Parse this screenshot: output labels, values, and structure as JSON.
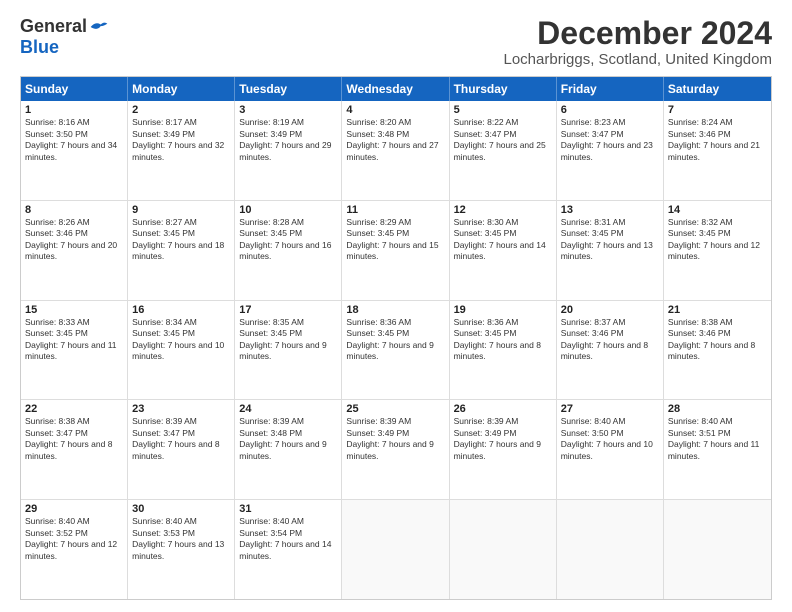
{
  "logo": {
    "general": "General",
    "blue": "Blue"
  },
  "header": {
    "title": "December 2024",
    "location": "Locharbriggs, Scotland, United Kingdom"
  },
  "days": [
    "Sunday",
    "Monday",
    "Tuesday",
    "Wednesday",
    "Thursday",
    "Friday",
    "Saturday"
  ],
  "weeks": [
    [
      {
        "day": "1",
        "sunrise": "8:16 AM",
        "sunset": "3:50 PM",
        "daylight": "7 hours and 34 minutes."
      },
      {
        "day": "2",
        "sunrise": "8:17 AM",
        "sunset": "3:49 PM",
        "daylight": "7 hours and 32 minutes."
      },
      {
        "day": "3",
        "sunrise": "8:19 AM",
        "sunset": "3:49 PM",
        "daylight": "7 hours and 29 minutes."
      },
      {
        "day": "4",
        "sunrise": "8:20 AM",
        "sunset": "3:48 PM",
        "daylight": "7 hours and 27 minutes."
      },
      {
        "day": "5",
        "sunrise": "8:22 AM",
        "sunset": "3:47 PM",
        "daylight": "7 hours and 25 minutes."
      },
      {
        "day": "6",
        "sunrise": "8:23 AM",
        "sunset": "3:47 PM",
        "daylight": "7 hours and 23 minutes."
      },
      {
        "day": "7",
        "sunrise": "8:24 AM",
        "sunset": "3:46 PM",
        "daylight": "7 hours and 21 minutes."
      }
    ],
    [
      {
        "day": "8",
        "sunrise": "8:26 AM",
        "sunset": "3:46 PM",
        "daylight": "7 hours and 20 minutes."
      },
      {
        "day": "9",
        "sunrise": "8:27 AM",
        "sunset": "3:45 PM",
        "daylight": "7 hours and 18 minutes."
      },
      {
        "day": "10",
        "sunrise": "8:28 AM",
        "sunset": "3:45 PM",
        "daylight": "7 hours and 16 minutes."
      },
      {
        "day": "11",
        "sunrise": "8:29 AM",
        "sunset": "3:45 PM",
        "daylight": "7 hours and 15 minutes."
      },
      {
        "day": "12",
        "sunrise": "8:30 AM",
        "sunset": "3:45 PM",
        "daylight": "7 hours and 14 minutes."
      },
      {
        "day": "13",
        "sunrise": "8:31 AM",
        "sunset": "3:45 PM",
        "daylight": "7 hours and 13 minutes."
      },
      {
        "day": "14",
        "sunrise": "8:32 AM",
        "sunset": "3:45 PM",
        "daylight": "7 hours and 12 minutes."
      }
    ],
    [
      {
        "day": "15",
        "sunrise": "8:33 AM",
        "sunset": "3:45 PM",
        "daylight": "7 hours and 11 minutes."
      },
      {
        "day": "16",
        "sunrise": "8:34 AM",
        "sunset": "3:45 PM",
        "daylight": "7 hours and 10 minutes."
      },
      {
        "day": "17",
        "sunrise": "8:35 AM",
        "sunset": "3:45 PM",
        "daylight": "7 hours and 9 minutes."
      },
      {
        "day": "18",
        "sunrise": "8:36 AM",
        "sunset": "3:45 PM",
        "daylight": "7 hours and 9 minutes."
      },
      {
        "day": "19",
        "sunrise": "8:36 AM",
        "sunset": "3:45 PM",
        "daylight": "7 hours and 8 minutes."
      },
      {
        "day": "20",
        "sunrise": "8:37 AM",
        "sunset": "3:46 PM",
        "daylight": "7 hours and 8 minutes."
      },
      {
        "day": "21",
        "sunrise": "8:38 AM",
        "sunset": "3:46 PM",
        "daylight": "7 hours and 8 minutes."
      }
    ],
    [
      {
        "day": "22",
        "sunrise": "8:38 AM",
        "sunset": "3:47 PM",
        "daylight": "7 hours and 8 minutes."
      },
      {
        "day": "23",
        "sunrise": "8:39 AM",
        "sunset": "3:47 PM",
        "daylight": "7 hours and 8 minutes."
      },
      {
        "day": "24",
        "sunrise": "8:39 AM",
        "sunset": "3:48 PM",
        "daylight": "7 hours and 9 minutes."
      },
      {
        "day": "25",
        "sunrise": "8:39 AM",
        "sunset": "3:49 PM",
        "daylight": "7 hours and 9 minutes."
      },
      {
        "day": "26",
        "sunrise": "8:39 AM",
        "sunset": "3:49 PM",
        "daylight": "7 hours and 9 minutes."
      },
      {
        "day": "27",
        "sunrise": "8:40 AM",
        "sunset": "3:50 PM",
        "daylight": "7 hours and 10 minutes."
      },
      {
        "day": "28",
        "sunrise": "8:40 AM",
        "sunset": "3:51 PM",
        "daylight": "7 hours and 11 minutes."
      }
    ],
    [
      {
        "day": "29",
        "sunrise": "8:40 AM",
        "sunset": "3:52 PM",
        "daylight": "7 hours and 12 minutes."
      },
      {
        "day": "30",
        "sunrise": "8:40 AM",
        "sunset": "3:53 PM",
        "daylight": "7 hours and 13 minutes."
      },
      {
        "day": "31",
        "sunrise": "8:40 AM",
        "sunset": "3:54 PM",
        "daylight": "7 hours and 14 minutes."
      },
      null,
      null,
      null,
      null
    ]
  ]
}
